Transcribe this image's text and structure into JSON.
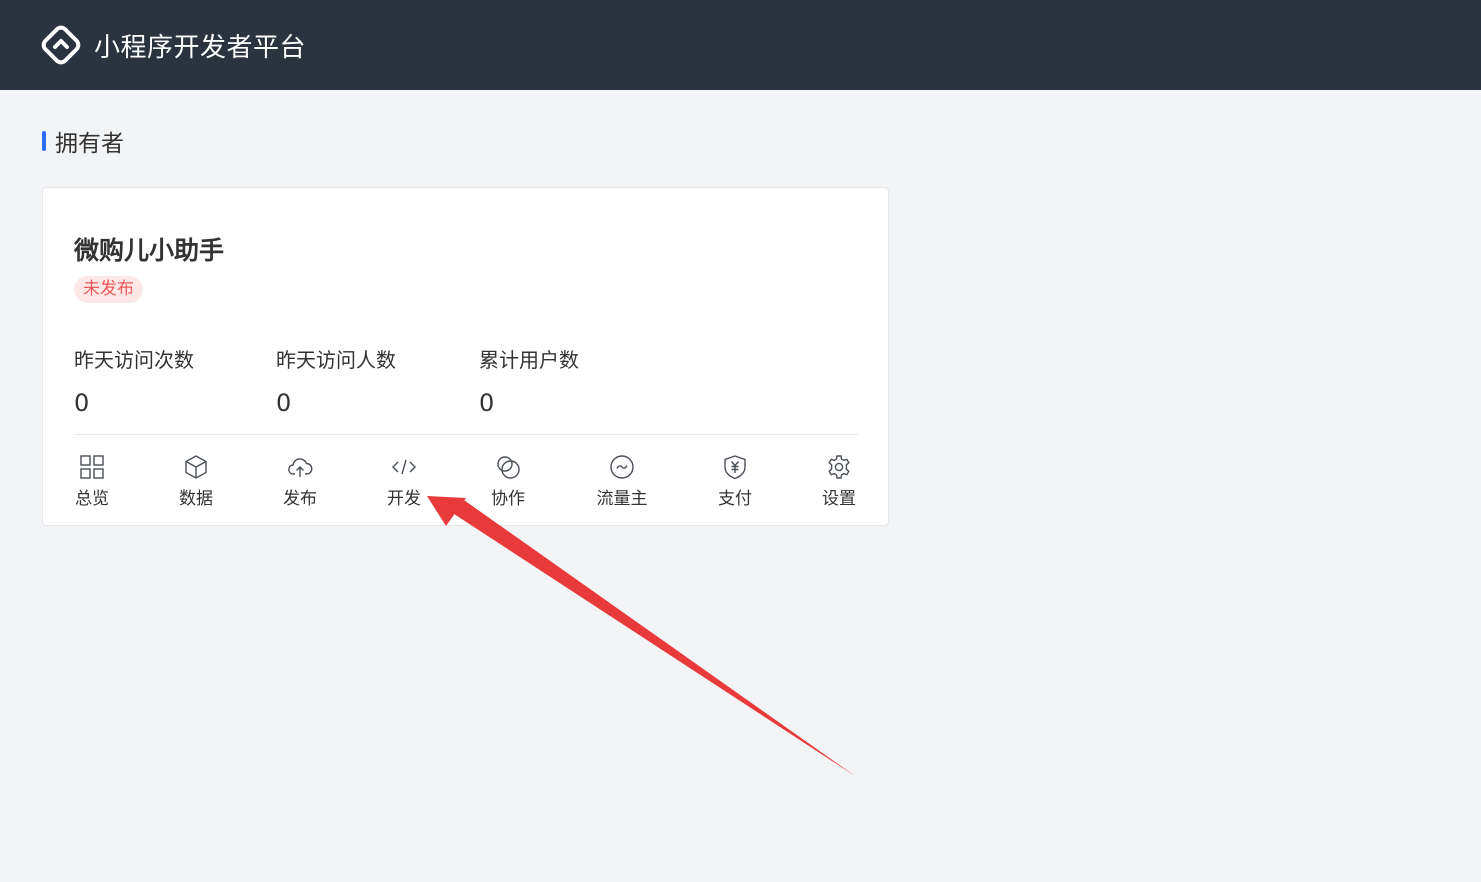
{
  "header": {
    "app_title": "小程序开发者平台",
    "logo_icon": "platform-logo-icon"
  },
  "section": {
    "title": "拥有者"
  },
  "card": {
    "name": "微购儿小助手",
    "status": "未发布",
    "stats": [
      {
        "label": "昨天访问次数",
        "value": "0"
      },
      {
        "label": "昨天访问人数",
        "value": "0"
      },
      {
        "label": "累计用户数",
        "value": "0"
      }
    ],
    "nav": [
      {
        "label": "总览",
        "icon": "grid-icon"
      },
      {
        "label": "数据",
        "icon": "cube-icon"
      },
      {
        "label": "发布",
        "icon": "cloud-upload-icon"
      },
      {
        "label": "开发",
        "icon": "code-icon"
      },
      {
        "label": "协作",
        "icon": "overlap-circles-icon"
      },
      {
        "label": "流量主",
        "icon": "wave-circle-icon"
      },
      {
        "label": "支付",
        "icon": "yuan-shield-icon"
      },
      {
        "label": "设置",
        "icon": "gear-icon"
      }
    ]
  },
  "colors": {
    "header_bg": "#2b3240",
    "accent": "#2d6df6",
    "status": "#ef5a5a",
    "annotation_arrow": "#e83a3a"
  }
}
